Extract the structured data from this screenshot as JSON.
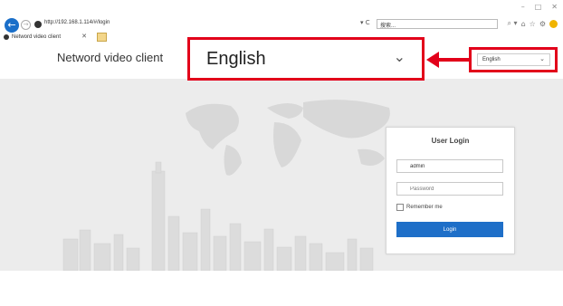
{
  "browser": {
    "window_controls": [
      "–",
      "□",
      "✕"
    ],
    "url": "http://192.168.1.114/#/login",
    "refresh_label": "▾ C",
    "search_text": "搜索...",
    "right_icons": [
      "⌕ ▾",
      "⌂",
      "☆",
      "⚙"
    ],
    "tab_title": "Netword video client",
    "tab_close": "✕"
  },
  "header": {
    "title": "Netword video client",
    "language": {
      "selected": "English",
      "chevron": "⌄"
    }
  },
  "callout": {
    "language": "English",
    "chevron": "⌄"
  },
  "login": {
    "title": "User Login",
    "username_value": "admin",
    "password_placeholder": "Password",
    "remember_label": "Remember me",
    "submit_label": "Login",
    "user_icon": "👤",
    "lock_icon": "🔒"
  },
  "colors": {
    "accent": "#1e6fc8",
    "annotation_red": "#e2001a",
    "hero_bg": "#ececec"
  }
}
